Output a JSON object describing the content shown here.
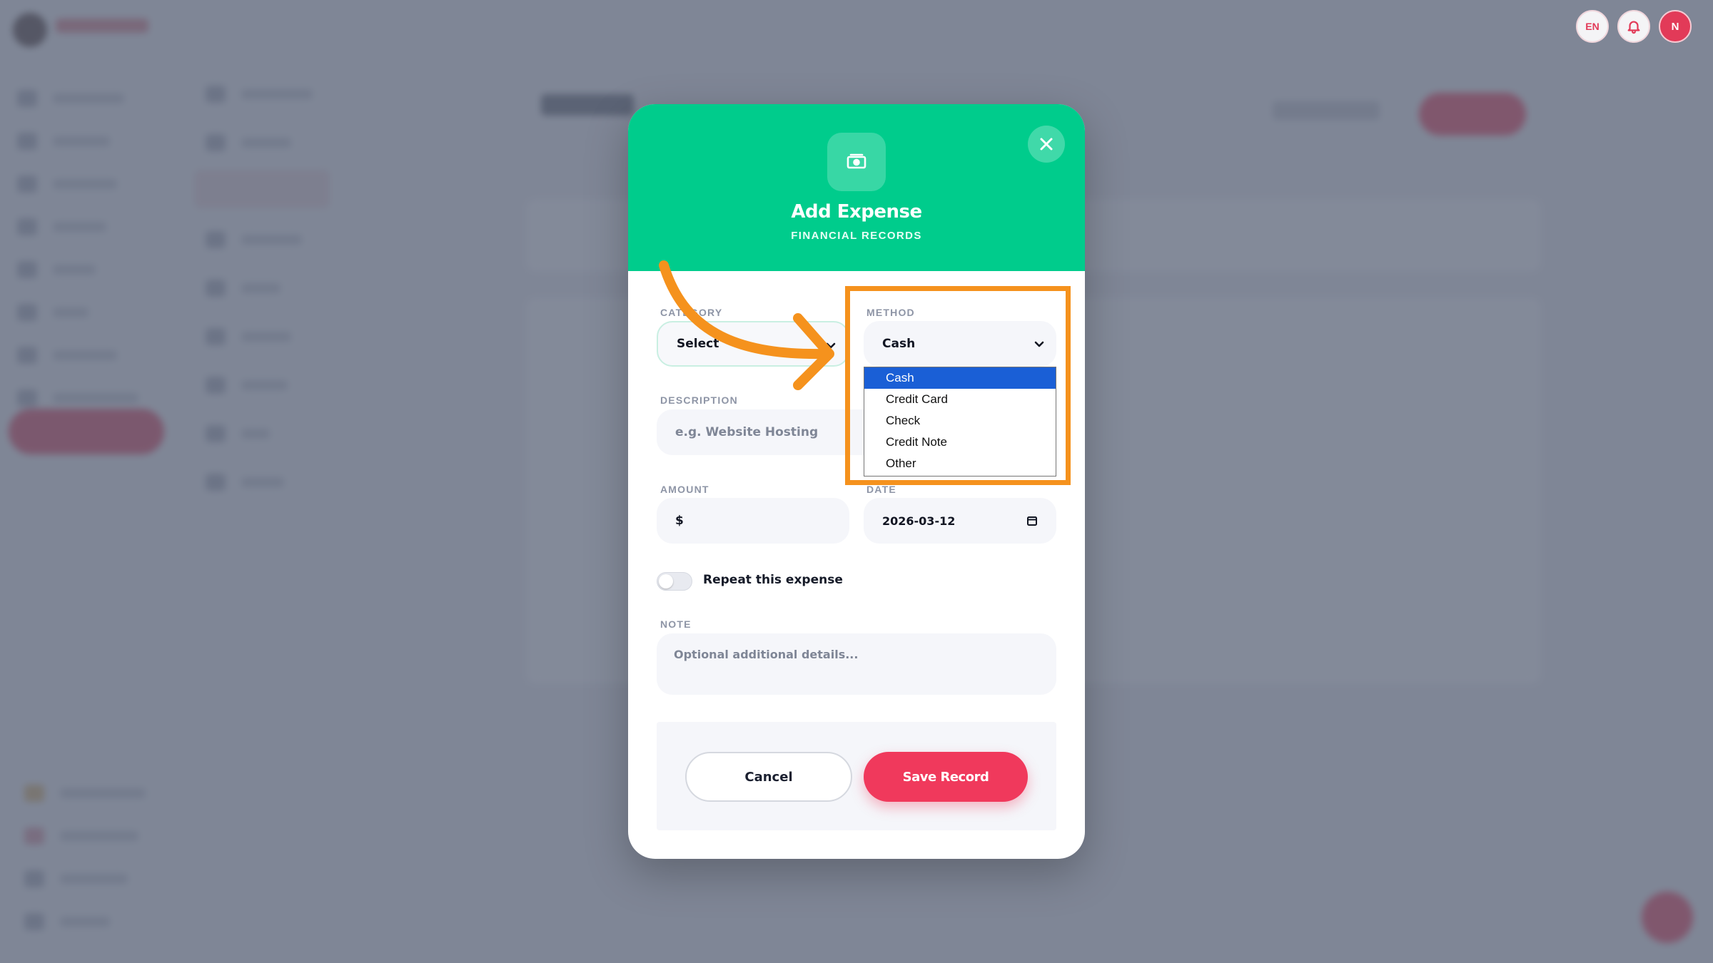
{
  "top_bar": {
    "language_label": "EN",
    "avatar_initial": "N",
    "icons": [
      "language-icon",
      "bell-icon",
      "avatar"
    ]
  },
  "modal": {
    "title": "Add Expense",
    "subtitle": "FINANCIAL RECORDS",
    "header_icon": "money-icon",
    "colors": {
      "header": "#00cc8c",
      "save_button": "#f0395c",
      "highlight": "#f5921d",
      "selected_option": "#1a5fd6"
    },
    "category": {
      "label": "CATEGORY",
      "value": "Select"
    },
    "method": {
      "label": "METHOD",
      "value": "Cash",
      "options": [
        "Cash",
        "Credit Card",
        "Check",
        "Credit Note",
        "Other"
      ],
      "selected_index": 0
    },
    "description": {
      "label": "DESCRIPTION",
      "placeholder": "e.g. Website Hosting"
    },
    "amount": {
      "label": "AMOUNT",
      "currency": "$",
      "value": ""
    },
    "date": {
      "label": "DATE",
      "value": "2026-03-12"
    },
    "repeat": {
      "label": "Repeat this expense",
      "enabled": false
    },
    "note": {
      "label": "NOTE",
      "placeholder": "Optional additional details..."
    },
    "buttons": {
      "cancel": "Cancel",
      "save": "Save Record"
    }
  }
}
